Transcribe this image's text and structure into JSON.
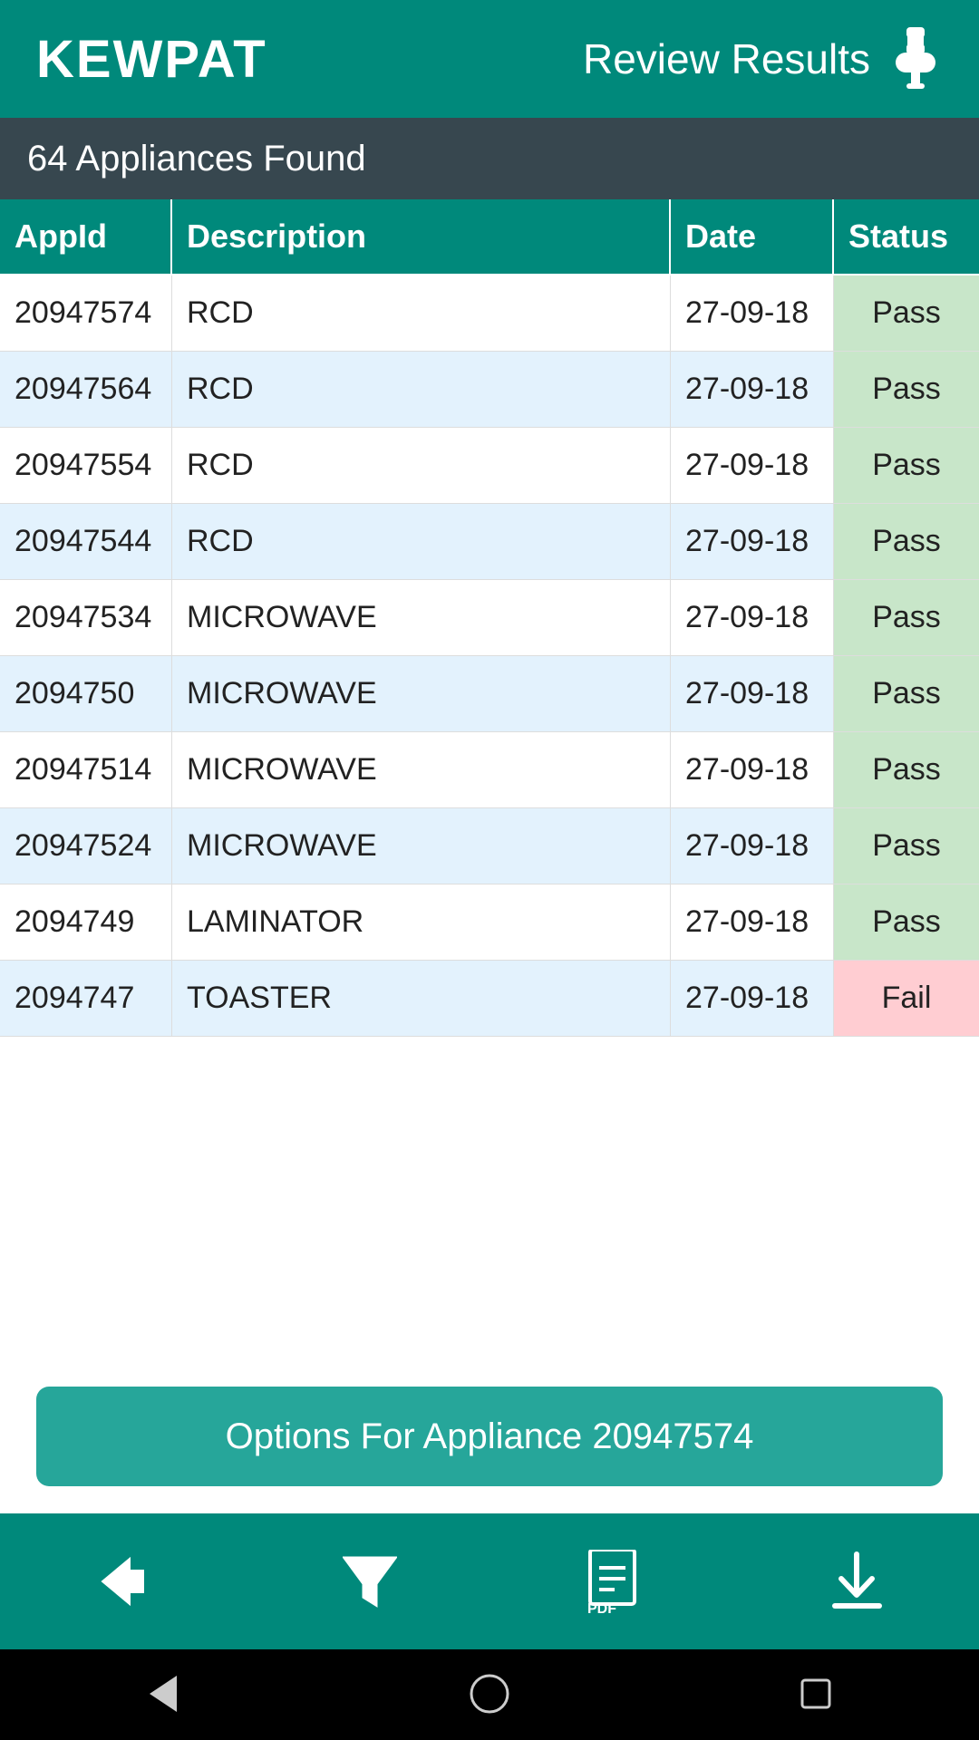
{
  "header": {
    "logo": "KEWPAT",
    "title": "Review Results"
  },
  "sub_header": {
    "text": "64 Appliances Found"
  },
  "table": {
    "columns": [
      "AppId",
      "Description",
      "Date",
      "Status"
    ],
    "rows": [
      {
        "id": "20947574",
        "description": "RCD",
        "date": "27-09-18",
        "status": "Pass",
        "status_type": "pass"
      },
      {
        "id": "20947564",
        "description": "RCD",
        "date": "27-09-18",
        "status": "Pass",
        "status_type": "pass"
      },
      {
        "id": "20947554",
        "description": "RCD",
        "date": "27-09-18",
        "status": "Pass",
        "status_type": "pass"
      },
      {
        "id": "20947544",
        "description": "RCD",
        "date": "27-09-18",
        "status": "Pass",
        "status_type": "pass"
      },
      {
        "id": "20947534",
        "description": "MICROWAVE",
        "date": "27-09-18",
        "status": "Pass",
        "status_type": "pass"
      },
      {
        "id": "2094750",
        "description": "MICROWAVE",
        "date": "27-09-18",
        "status": "Pass",
        "status_type": "pass"
      },
      {
        "id": "20947514",
        "description": "MICROWAVE",
        "date": "27-09-18",
        "status": "Pass",
        "status_type": "pass"
      },
      {
        "id": "20947524",
        "description": "MICROWAVE",
        "date": "27-09-18",
        "status": "Pass",
        "status_type": "pass"
      },
      {
        "id": "2094749",
        "description": "LAMINATOR",
        "date": "27-09-18",
        "status": "Pass",
        "status_type": "pass"
      },
      {
        "id": "2094747",
        "description": "TOASTER",
        "date": "27-09-18",
        "status": "Fail",
        "status_type": "fail"
      }
    ]
  },
  "options_button": {
    "label": "Options For Appliance 20947574"
  },
  "bottom_nav": {
    "back_label": "back",
    "filter_label": "filter",
    "pdf_label": "pdf",
    "download_label": "download"
  },
  "android_nav": {
    "back_label": "back",
    "home_label": "home",
    "recents_label": "recents"
  }
}
